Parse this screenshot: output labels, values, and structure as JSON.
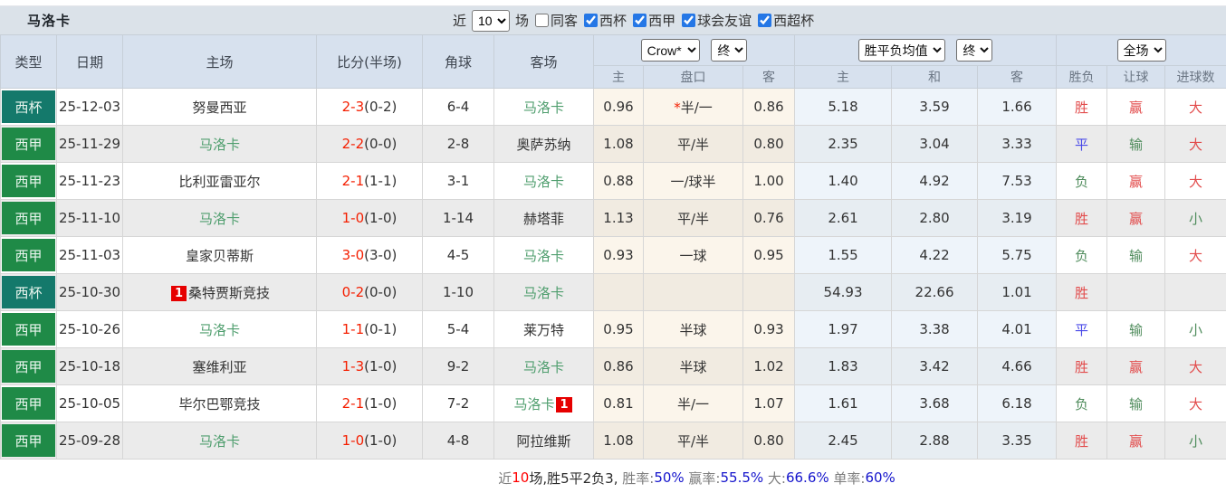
{
  "header": {
    "team_title": "马洛卡",
    "recent_label": "近",
    "matches_select_value": "10",
    "matches_suffix": "场",
    "same_venue_label": "同客",
    "same_venue_checked": false,
    "league_filters": [
      {
        "label": "西杯",
        "checked": true
      },
      {
        "label": "西甲",
        "checked": true
      },
      {
        "label": "球会友谊",
        "checked": true
      },
      {
        "label": "西超杯",
        "checked": true
      }
    ]
  },
  "table": {
    "columns": {
      "type": "类型",
      "date": "日期",
      "home": "主场",
      "score": "比分(半场)",
      "corner": "角球",
      "away": "客场"
    },
    "selects": {
      "bookmaker": "Crow*",
      "asian_stage": "终",
      "euro_model": "胜平负均值",
      "euro_stage": "终",
      "scope": "全场"
    },
    "sub_columns": {
      "asian_home": "主",
      "handicap": "盘口",
      "asian_away": "客",
      "euro_home": "主",
      "euro_draw": "和",
      "euro_away": "客",
      "result": "胜负",
      "let_ball": "让球",
      "goals": "进球数"
    },
    "rows": [
      {
        "type": "西杯",
        "type_color": "teal",
        "date": "25-12-03",
        "home": "努曼西亚",
        "home_is_team": false,
        "home_badge": "",
        "score": "2-3",
        "half": "(0-2)",
        "corner": "6-4",
        "away": "马洛卡",
        "away_is_team": true,
        "away_badge": "",
        "asian_home": "0.96",
        "handicap": "*半/一",
        "asian_away": "0.86",
        "euro_home": "5.18",
        "euro_draw": "3.59",
        "euro_away": "1.66",
        "result": "胜",
        "result_color": "red",
        "handicap_result": "赢",
        "handicap_result_color": "red",
        "goals": "大",
        "goals_color": "red"
      },
      {
        "type": "西甲",
        "type_color": "green",
        "date": "25-11-29",
        "home": "马洛卡",
        "home_is_team": true,
        "home_badge": "",
        "score": "2-2",
        "half": "(0-0)",
        "corner": "2-8",
        "away": "奥萨苏纳",
        "away_is_team": false,
        "away_badge": "",
        "asian_home": "1.08",
        "handicap": "平/半",
        "asian_away": "0.80",
        "euro_home": "2.35",
        "euro_draw": "3.04",
        "euro_away": "3.33",
        "result": "平",
        "result_color": "blue",
        "handicap_result": "输",
        "handicap_result_color": "green",
        "goals": "大",
        "goals_color": "red"
      },
      {
        "type": "西甲",
        "type_color": "green",
        "date": "25-11-23",
        "home": "比利亚雷亚尔",
        "home_is_team": false,
        "home_badge": "",
        "score": "2-1",
        "half": "(1-1)",
        "corner": "3-1",
        "away": "马洛卡",
        "away_is_team": true,
        "away_badge": "",
        "asian_home": "0.88",
        "handicap": "一/球半",
        "asian_away": "1.00",
        "euro_home": "1.40",
        "euro_draw": "4.92",
        "euro_away": "7.53",
        "result": "负",
        "result_color": "green",
        "handicap_result": "赢",
        "handicap_result_color": "red",
        "goals": "大",
        "goals_color": "red"
      },
      {
        "type": "西甲",
        "type_color": "green",
        "date": "25-11-10",
        "home": "马洛卡",
        "home_is_team": true,
        "home_badge": "",
        "score": "1-0",
        "half": "(1-0)",
        "corner": "1-14",
        "away": "赫塔菲",
        "away_is_team": false,
        "away_badge": "",
        "asian_home": "1.13",
        "handicap": "平/半",
        "asian_away": "0.76",
        "euro_home": "2.61",
        "euro_draw": "2.80",
        "euro_away": "3.19",
        "result": "胜",
        "result_color": "red",
        "handicap_result": "赢",
        "handicap_result_color": "red",
        "goals": "小",
        "goals_color": "green"
      },
      {
        "type": "西甲",
        "type_color": "green",
        "date": "25-11-03",
        "home": "皇家贝蒂斯",
        "home_is_team": false,
        "home_badge": "",
        "score": "3-0",
        "half": "(3-0)",
        "corner": "4-5",
        "away": "马洛卡",
        "away_is_team": true,
        "away_badge": "",
        "asian_home": "0.93",
        "handicap": "一球",
        "asian_away": "0.95",
        "euro_home": "1.55",
        "euro_draw": "4.22",
        "euro_away": "5.75",
        "result": "负",
        "result_color": "green",
        "handicap_result": "输",
        "handicap_result_color": "green",
        "goals": "大",
        "goals_color": "red"
      },
      {
        "type": "西杯",
        "type_color": "teal",
        "date": "25-10-30",
        "home": "桑特贾斯竞技",
        "home_is_team": false,
        "home_badge": "1",
        "score": "0-2",
        "half": "(0-0)",
        "corner": "1-10",
        "away": "马洛卡",
        "away_is_team": true,
        "away_badge": "",
        "asian_home": "",
        "handicap": "",
        "asian_away": "",
        "euro_home": "54.93",
        "euro_draw": "22.66",
        "euro_away": "1.01",
        "result": "胜",
        "result_color": "red",
        "handicap_result": "",
        "handicap_result_color": "",
        "goals": "",
        "goals_color": ""
      },
      {
        "type": "西甲",
        "type_color": "green",
        "date": "25-10-26",
        "home": "马洛卡",
        "home_is_team": true,
        "home_badge": "",
        "score": "1-1",
        "half": "(0-1)",
        "corner": "5-4",
        "away": "莱万特",
        "away_is_team": false,
        "away_badge": "",
        "asian_home": "0.95",
        "handicap": "半球",
        "asian_away": "0.93",
        "euro_home": "1.97",
        "euro_draw": "3.38",
        "euro_away": "4.01",
        "result": "平",
        "result_color": "blue",
        "handicap_result": "输",
        "handicap_result_color": "green",
        "goals": "小",
        "goals_color": "green"
      },
      {
        "type": "西甲",
        "type_color": "green",
        "date": "25-10-18",
        "home": "塞维利亚",
        "home_is_team": false,
        "home_badge": "",
        "score": "1-3",
        "half": "(1-0)",
        "corner": "9-2",
        "away": "马洛卡",
        "away_is_team": true,
        "away_badge": "",
        "asian_home": "0.86",
        "handicap": "半球",
        "asian_away": "1.02",
        "euro_home": "1.83",
        "euro_draw": "3.42",
        "euro_away": "4.66",
        "result": "胜",
        "result_color": "red",
        "handicap_result": "赢",
        "handicap_result_color": "red",
        "goals": "大",
        "goals_color": "red"
      },
      {
        "type": "西甲",
        "type_color": "green",
        "date": "25-10-05",
        "home": "毕尔巴鄂竞技",
        "home_is_team": false,
        "home_badge": "",
        "score": "2-1",
        "half": "(1-0)",
        "corner": "7-2",
        "away": "马洛卡",
        "away_is_team": true,
        "away_badge": "1",
        "asian_home": "0.81",
        "handicap": "半/一",
        "asian_away": "1.07",
        "euro_home": "1.61",
        "euro_draw": "3.68",
        "euro_away": "6.18",
        "result": "负",
        "result_color": "green",
        "handicap_result": "输",
        "handicap_result_color": "green",
        "goals": "大",
        "goals_color": "red"
      },
      {
        "type": "西甲",
        "type_color": "green",
        "date": "25-09-28",
        "home": "马洛卡",
        "home_is_team": true,
        "home_badge": "",
        "score": "1-0",
        "half": "(1-0)",
        "corner": "4-8",
        "away": "阿拉维斯",
        "away_is_team": false,
        "away_badge": "",
        "asian_home": "1.08",
        "handicap": "平/半",
        "asian_away": "0.80",
        "euro_home": "2.45",
        "euro_draw": "2.88",
        "euro_away": "3.35",
        "result": "胜",
        "result_color": "red",
        "handicap_result": "赢",
        "handicap_result_color": "red",
        "goals": "小",
        "goals_color": "green"
      }
    ]
  },
  "footer": {
    "segments": [
      {
        "text": "近",
        "color": "gray"
      },
      {
        "text": "10",
        "color": "red"
      },
      {
        "text": "场,胜5平2负3, ",
        "color": "dark"
      },
      {
        "text": "胜率:",
        "color": "gray"
      },
      {
        "text": "50%",
        "color": "blue"
      },
      {
        "text": " 赢率:",
        "color": "gray"
      },
      {
        "text": "55.5%",
        "color": "blue"
      },
      {
        "text": " 大:",
        "color": "gray"
      },
      {
        "text": "66.6%",
        "color": "blue"
      },
      {
        "text": " 单率:",
        "color": "gray"
      },
      {
        "text": "60%",
        "color": "blue"
      }
    ]
  }
}
